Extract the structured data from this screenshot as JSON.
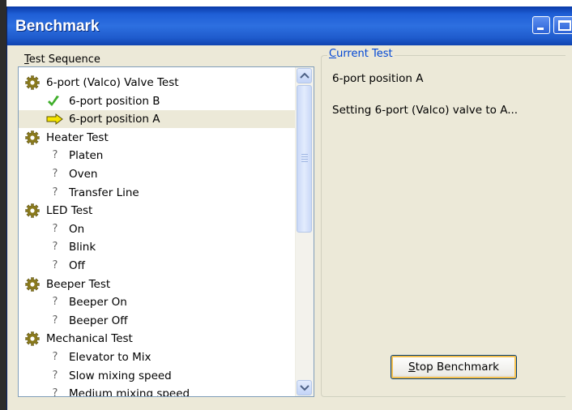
{
  "window": {
    "title": "Benchmark"
  },
  "test_sequence": {
    "label_accel": "T",
    "label_rest": "est Sequence",
    "items": [
      {
        "kind": "group",
        "status": "running",
        "icon": "gear-icon",
        "label": "6-port (Valco) Valve Test"
      },
      {
        "kind": "step",
        "status": "passed",
        "icon": "check-icon",
        "label": "6-port position B"
      },
      {
        "kind": "step",
        "status": "current",
        "icon": "arrow-icon",
        "label": "6-port position A"
      },
      {
        "kind": "group",
        "status": "pending",
        "icon": "gear-icon",
        "label": "Heater Test"
      },
      {
        "kind": "step",
        "status": "pending",
        "icon": "question-icon",
        "label": "Platen"
      },
      {
        "kind": "step",
        "status": "pending",
        "icon": "question-icon",
        "label": "Oven"
      },
      {
        "kind": "step",
        "status": "pending",
        "icon": "question-icon",
        "label": "Transfer Line"
      },
      {
        "kind": "group",
        "status": "pending",
        "icon": "gear-icon",
        "label": "LED Test"
      },
      {
        "kind": "step",
        "status": "pending",
        "icon": "question-icon",
        "label": "On"
      },
      {
        "kind": "step",
        "status": "pending",
        "icon": "question-icon",
        "label": "Blink"
      },
      {
        "kind": "step",
        "status": "pending",
        "icon": "question-icon",
        "label": "Off"
      },
      {
        "kind": "group",
        "status": "pending",
        "icon": "gear-icon",
        "label": "Beeper Test"
      },
      {
        "kind": "step",
        "status": "pending",
        "icon": "question-icon",
        "label": "Beeper On"
      },
      {
        "kind": "step",
        "status": "pending",
        "icon": "question-icon",
        "label": "Beeper Off"
      },
      {
        "kind": "group",
        "status": "pending",
        "icon": "gear-icon",
        "label": "Mechanical Test"
      },
      {
        "kind": "step",
        "status": "pending",
        "icon": "question-icon",
        "label": "Elevator to Mix"
      },
      {
        "kind": "step",
        "status": "pending",
        "icon": "question-icon",
        "label": "Slow mixing speed"
      },
      {
        "kind": "step",
        "status": "pending",
        "icon": "question-icon",
        "label": "Medium mixing speed"
      }
    ],
    "question_glyph": "?"
  },
  "current_test": {
    "label_accel": "C",
    "label_rest": "urrent Test",
    "name": "6-port position A",
    "status": "Setting 6-port (Valco) valve to A..."
  },
  "buttons": {
    "stop_accel": "S",
    "stop_rest": "top Benchmark"
  },
  "colors": {
    "titlebar": "#2d6fe0",
    "window_bg": "#ece9d8",
    "group_label": "#0046d5",
    "check": "#3fae2a",
    "arrow": "#f5e400",
    "gear": "#8a7a1c"
  }
}
